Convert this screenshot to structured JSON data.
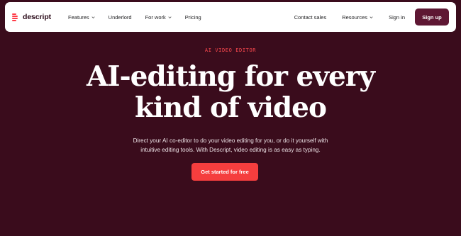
{
  "brand": {
    "name": "descript",
    "icon": "descript-logo-icon"
  },
  "nav": {
    "left": [
      {
        "label": "Features",
        "dropdown": true
      },
      {
        "label": "Underlord",
        "dropdown": false
      },
      {
        "label": "For work",
        "dropdown": true
      },
      {
        "label": "Pricing",
        "dropdown": false
      }
    ],
    "right": [
      {
        "label": "Contact sales",
        "dropdown": false
      },
      {
        "label": "Resources",
        "dropdown": true
      },
      {
        "label": "Sign in",
        "dropdown": false
      }
    ],
    "signup_label": "Sign up"
  },
  "hero": {
    "eyebrow": "AI VIDEO EDITOR",
    "headline_line1": "AI-editing for every",
    "headline_line2": "kind of video",
    "sub_line1": "Direct your AI co-editor to do your video editing for you, or do it yourself with",
    "sub_line2": "intuitive editing tools. With Descript, video editing is as easy as typing.",
    "cta_label": "Get started for free"
  },
  "colors": {
    "background": "#3a0c1c",
    "accent": "#f53e3e",
    "signup": "#5e1733",
    "eyebrow": "#ff4a4f"
  }
}
